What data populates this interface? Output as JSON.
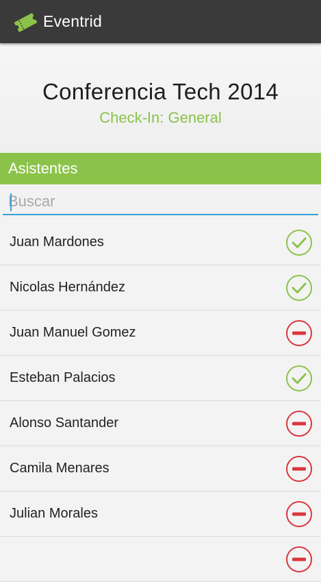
{
  "appbar": {
    "title": "Eventrid",
    "icon": "ticket-icon",
    "icon_color": "#8bc34a",
    "background": "#3a3a3a"
  },
  "event": {
    "title": "Conferencia Tech 2014",
    "subtitle": "Check-In: General",
    "subtitle_color": "#8bc34a"
  },
  "section": {
    "title": "Asistentes",
    "color": "#8bc34a"
  },
  "search": {
    "placeholder": "Buscar",
    "value": ""
  },
  "status_colors": {
    "checked_in": "#8bc34a",
    "not_checked_in": "#d9363e"
  },
  "attendees": [
    {
      "name": "Juan Mardones",
      "status": "checked_in"
    },
    {
      "name": "Nicolas Hernández",
      "status": "checked_in"
    },
    {
      "name": "Juan Manuel Gomez",
      "status": "not_checked_in"
    },
    {
      "name": "Esteban Palacios",
      "status": "checked_in"
    },
    {
      "name": "Alonso Santander",
      "status": "not_checked_in"
    },
    {
      "name": "Camila Menares",
      "status": "not_checked_in"
    },
    {
      "name": "Julian Morales",
      "status": "not_checked_in"
    },
    {
      "name": "",
      "status": "not_checked_in"
    }
  ]
}
